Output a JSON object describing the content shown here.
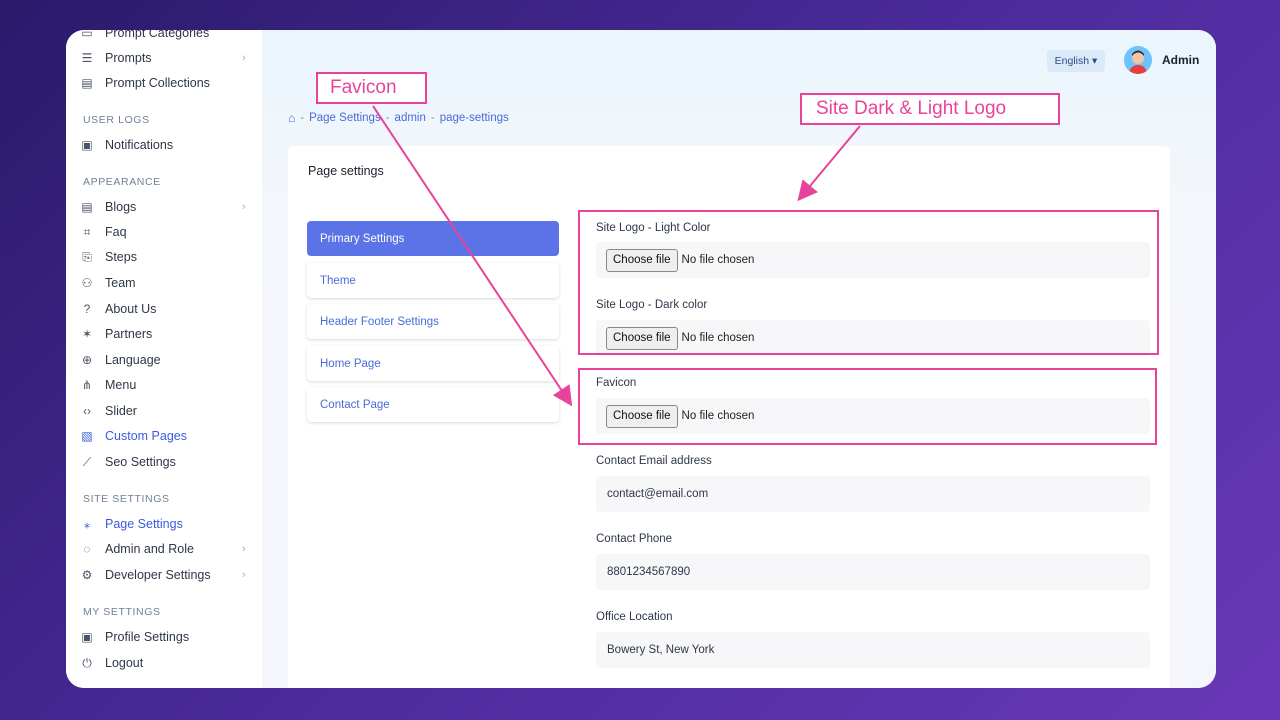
{
  "sidebar": {
    "items": [
      {
        "label": "Prompt Categories",
        "icon": "folder-icon"
      },
      {
        "label": "Prompts",
        "icon": "list-icon",
        "chevron": "›"
      },
      {
        "label": "Prompt Collections",
        "icon": "collection-icon"
      },
      {
        "label": "Notifications",
        "icon": "notification-icon"
      },
      {
        "label": "Blogs",
        "icon": "blog-icon",
        "chevron": "›"
      },
      {
        "label": "Faq",
        "icon": "faq-icon"
      },
      {
        "label": "Steps",
        "icon": "steps-icon"
      },
      {
        "label": "Team",
        "icon": "team-icon"
      },
      {
        "label": "About Us",
        "icon": "question-circle-icon"
      },
      {
        "label": "Partners",
        "icon": "partners-icon"
      },
      {
        "label": "Language",
        "icon": "globe-icon"
      },
      {
        "label": "Menu",
        "icon": "menu-icon"
      },
      {
        "label": "Slider",
        "icon": "code-icon"
      },
      {
        "label": "Custom Pages",
        "icon": "custom-pages-icon"
      },
      {
        "label": "Seo Settings",
        "icon": "chart-icon"
      },
      {
        "label": "Page Settings",
        "icon": "magic-wand-icon"
      },
      {
        "label": "Admin and Role",
        "icon": "shield-icon",
        "chevron": "›"
      },
      {
        "label": "Developer Settings",
        "icon": "gear-icon",
        "chevron": "›"
      },
      {
        "label": "Profile Settings",
        "icon": "profile-icon"
      },
      {
        "label": "Logout",
        "icon": "power-icon"
      }
    ],
    "sections": [
      "USER LOGS",
      "APPEARANCE",
      "SITE SETTINGS",
      "MY SETTINGS"
    ]
  },
  "header": {
    "language": "English ▾",
    "user_name": "Admin"
  },
  "breadcrumb": {
    "home_icon": "home-icon",
    "sep": "-",
    "items": [
      "Page Settings",
      "admin",
      "page-settings"
    ]
  },
  "card": {
    "title": "Page settings",
    "tabs": [
      "Primary Settings",
      "Theme",
      "Header Footer Settings",
      "Home Page",
      "Contact Page"
    ]
  },
  "form": {
    "logo_light_label": "Site Logo - Light Color",
    "logo_dark_label": "Site Logo - Dark color",
    "favicon_label": "Favicon",
    "choose_file": "Choose file",
    "no_file": "No file chosen",
    "email_label": "Contact Email address",
    "email_value": "contact@email.com",
    "phone_label": "Contact Phone",
    "phone_value": "8801234567890",
    "office_label": "Office Location",
    "office_value": "Bowery St, New York"
  },
  "annotations": {
    "favicon": "Favicon",
    "logo": "Site Dark & Light Logo",
    "color": "#e8439a"
  }
}
